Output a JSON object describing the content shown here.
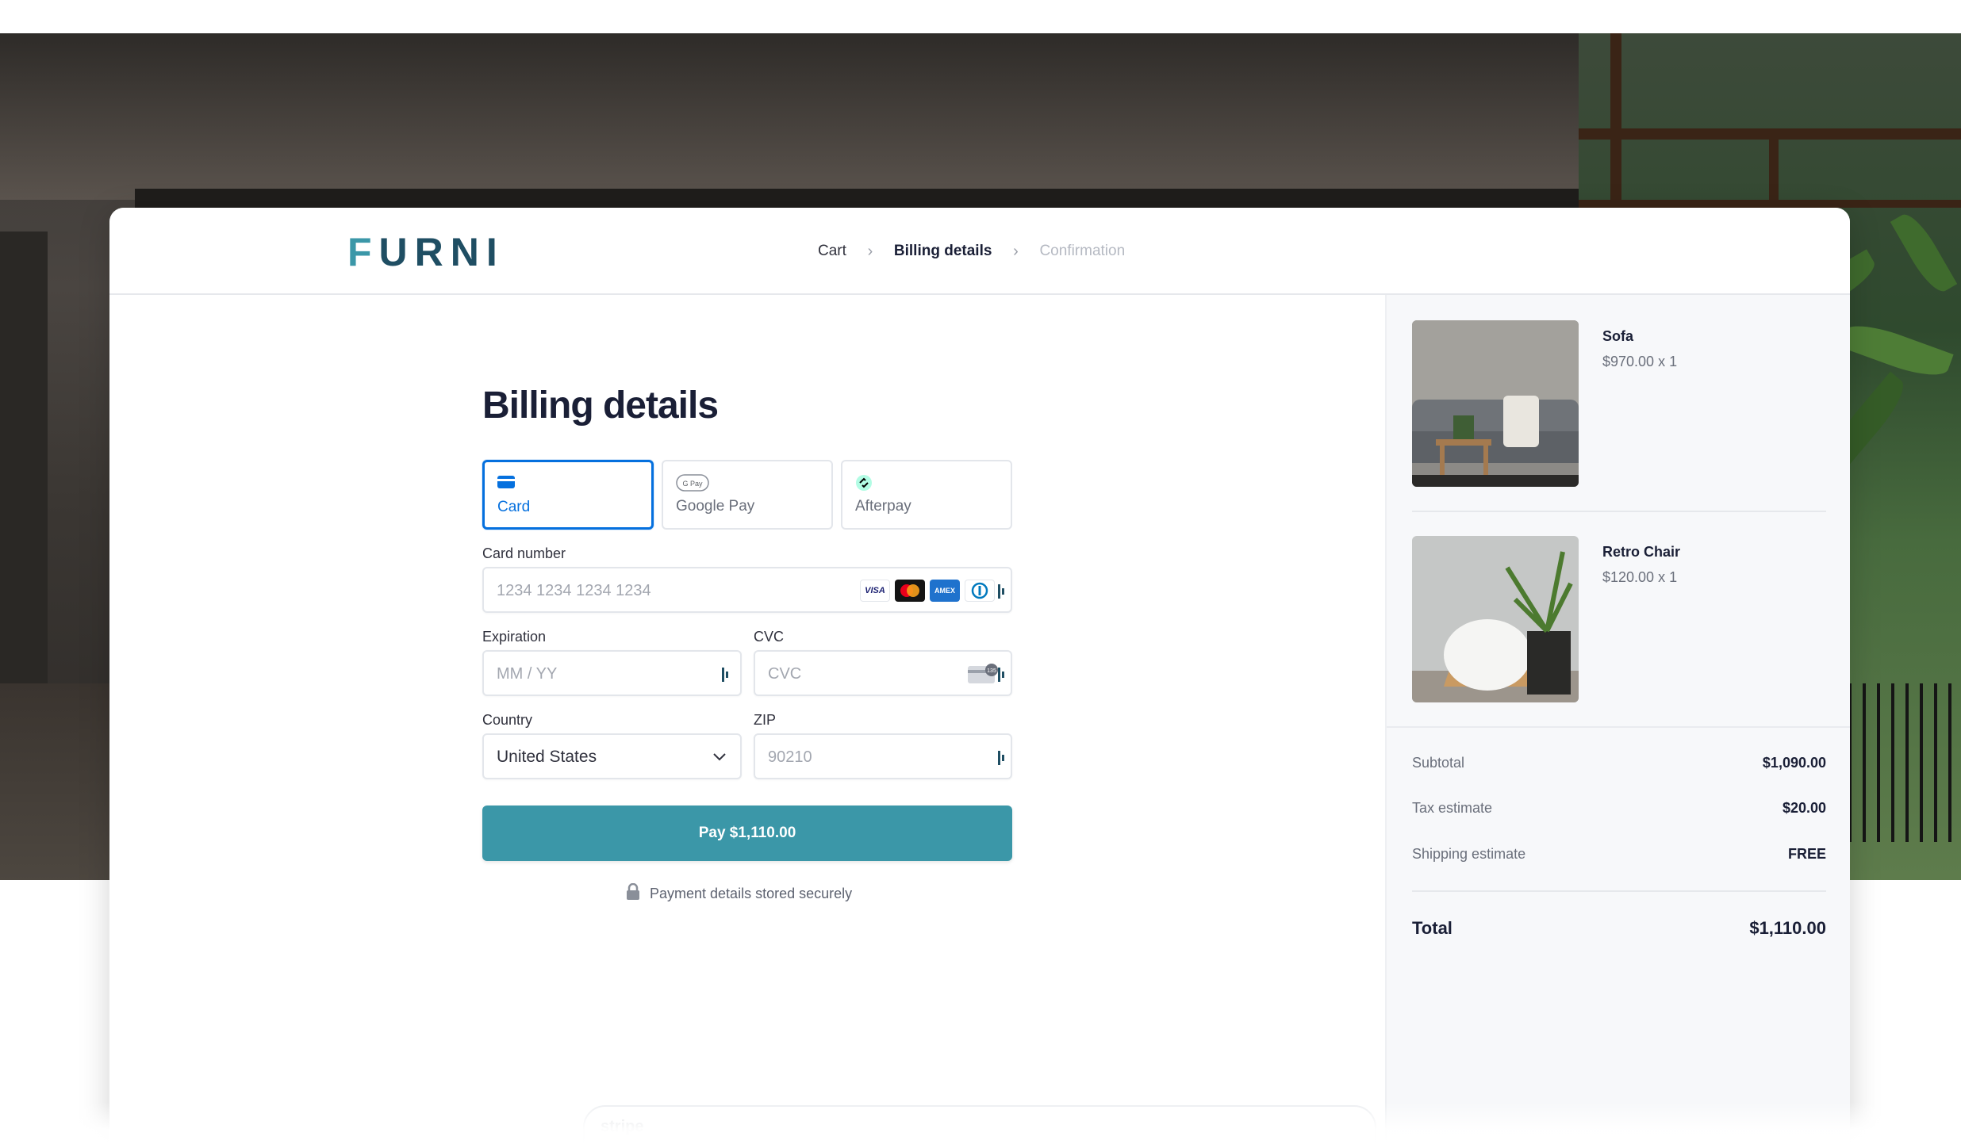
{
  "brand": {
    "logo_text": "FURNI",
    "accent": "#3b97a8",
    "dark": "#1f4e63"
  },
  "breadcrumb": {
    "items": [
      {
        "label": "Cart",
        "state": "done"
      },
      {
        "label": "Billing details",
        "state": "current"
      },
      {
        "label": "Confirmation",
        "state": "upcoming"
      }
    ],
    "separator": "›"
  },
  "form": {
    "title": "Billing details",
    "payment_methods": [
      {
        "label": "Card",
        "icon": "credit-card-icon",
        "selected": true
      },
      {
        "label": "Google Pay",
        "icon": "google-pay-icon",
        "selected": false
      },
      {
        "label": "Afterpay",
        "icon": "afterpay-icon",
        "selected": false
      }
    ],
    "card_number": {
      "label": "Card number",
      "placeholder": "1234 1234 1234 1234",
      "brands": [
        "VISA",
        "mastercard",
        "amex",
        "diners"
      ]
    },
    "expiration": {
      "label": "Expiration",
      "placeholder": "MM / YY"
    },
    "cvc": {
      "label": "CVC",
      "placeholder": "CVC"
    },
    "country": {
      "label": "Country",
      "value": "United States"
    },
    "zip": {
      "label": "ZIP",
      "placeholder": "90210"
    },
    "pay_button": "Pay $1,110.00",
    "secure_note": "Payment details stored securely"
  },
  "summary": {
    "items": [
      {
        "name": "Sofa",
        "price": "$970.00 x 1"
      },
      {
        "name": "Retro Chair",
        "price": "$120.00 x 1"
      }
    ],
    "rows": [
      {
        "label": "Subtotal",
        "value": "$1,090.00"
      },
      {
        "label": "Tax estimate",
        "value": "$20.00"
      },
      {
        "label": "Shipping estimate",
        "value": "FREE"
      }
    ],
    "total": {
      "label": "Total",
      "value": "$1,110.00"
    }
  },
  "footer": {
    "ghost_text": "stripe"
  }
}
